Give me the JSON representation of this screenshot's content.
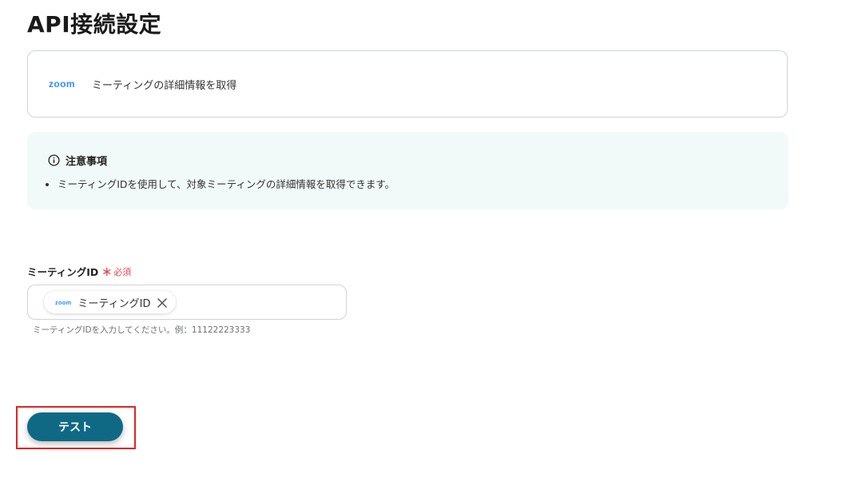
{
  "page": {
    "title": "API接続設定"
  },
  "app_card": {
    "logo_text": "zoom",
    "action_label": "ミーティングの詳細情報を取得"
  },
  "notice": {
    "icon": "info-circle-icon",
    "title": "注意事項",
    "items": [
      "ミーティングIDを使用して、対象ミーティングの詳細情報を取得できます。"
    ]
  },
  "meeting_id_field": {
    "label": "ミーティングID",
    "required_mark": "＊",
    "required_text": "必須",
    "chip": {
      "logo_text": "zoom",
      "label": "ミーティングID",
      "remove_icon": "close-icon"
    },
    "help_text": "ミーティングIDを入力してください。例：11122223333"
  },
  "actions": {
    "test_label": "テスト"
  },
  "colors": {
    "zoom_brand": "#2d8cff",
    "notice_bg": "#f1faf8",
    "required": "#e5484d",
    "primary_button": "#0f6985",
    "highlight": "#e02424"
  }
}
